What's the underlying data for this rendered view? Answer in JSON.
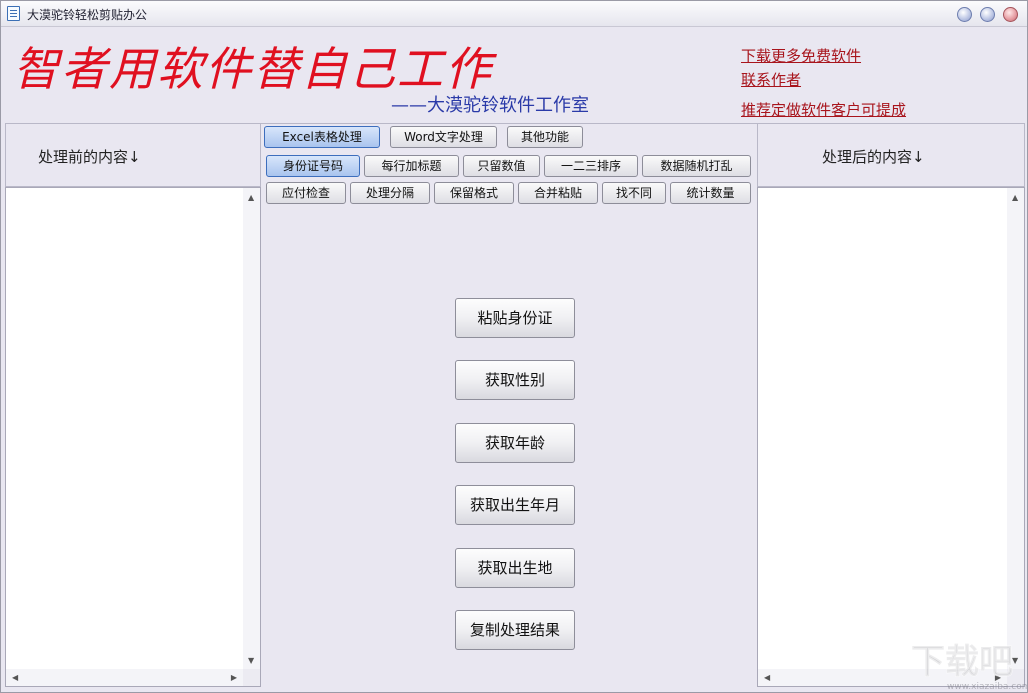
{
  "window": {
    "title": "大漠驼铃轻松剪贴办公",
    "icon": "document-icon"
  },
  "header": {
    "slogan": "智者用软件替自己工作",
    "studio": "——大漠驼铃软件工作室",
    "links": [
      "下载更多免费软件",
      "联系作者",
      "推荐定做软件客户可提成"
    ]
  },
  "left_panel": {
    "label": "处理前的内容↓"
  },
  "right_panel": {
    "label": "处理后的内容↓"
  },
  "main_tabs": [
    {
      "label": "Excel表格处理",
      "active": true
    },
    {
      "label": "Word文字处理",
      "active": false
    },
    {
      "label": "其他功能",
      "active": false
    }
  ],
  "sub_tabs_row1": [
    {
      "label": "身份证号码",
      "active": true
    },
    {
      "label": "每行加标题",
      "active": false
    },
    {
      "label": "只留数值",
      "active": false
    },
    {
      "label": "一二三排序",
      "active": false
    },
    {
      "label": "数据随机打乱",
      "active": false
    }
  ],
  "sub_tabs_row2": [
    {
      "label": "应付检查"
    },
    {
      "label": "处理分隔"
    },
    {
      "label": "保留格式"
    },
    {
      "label": "合并粘贴"
    },
    {
      "label": "找不同"
    },
    {
      "label": "统计数量"
    }
  ],
  "actions": [
    "粘贴身份证",
    "获取性别",
    "获取年龄",
    "获取出生年月",
    "获取出生地",
    "复制处理结果"
  ],
  "watermark": {
    "text": "下载吧",
    "url_text": "www.xiazaiba.com"
  },
  "colors": {
    "slogan": "#e01020",
    "studio": "#2a3aa8",
    "link": "#a8141c",
    "active_tab": "#a9c4ee"
  }
}
